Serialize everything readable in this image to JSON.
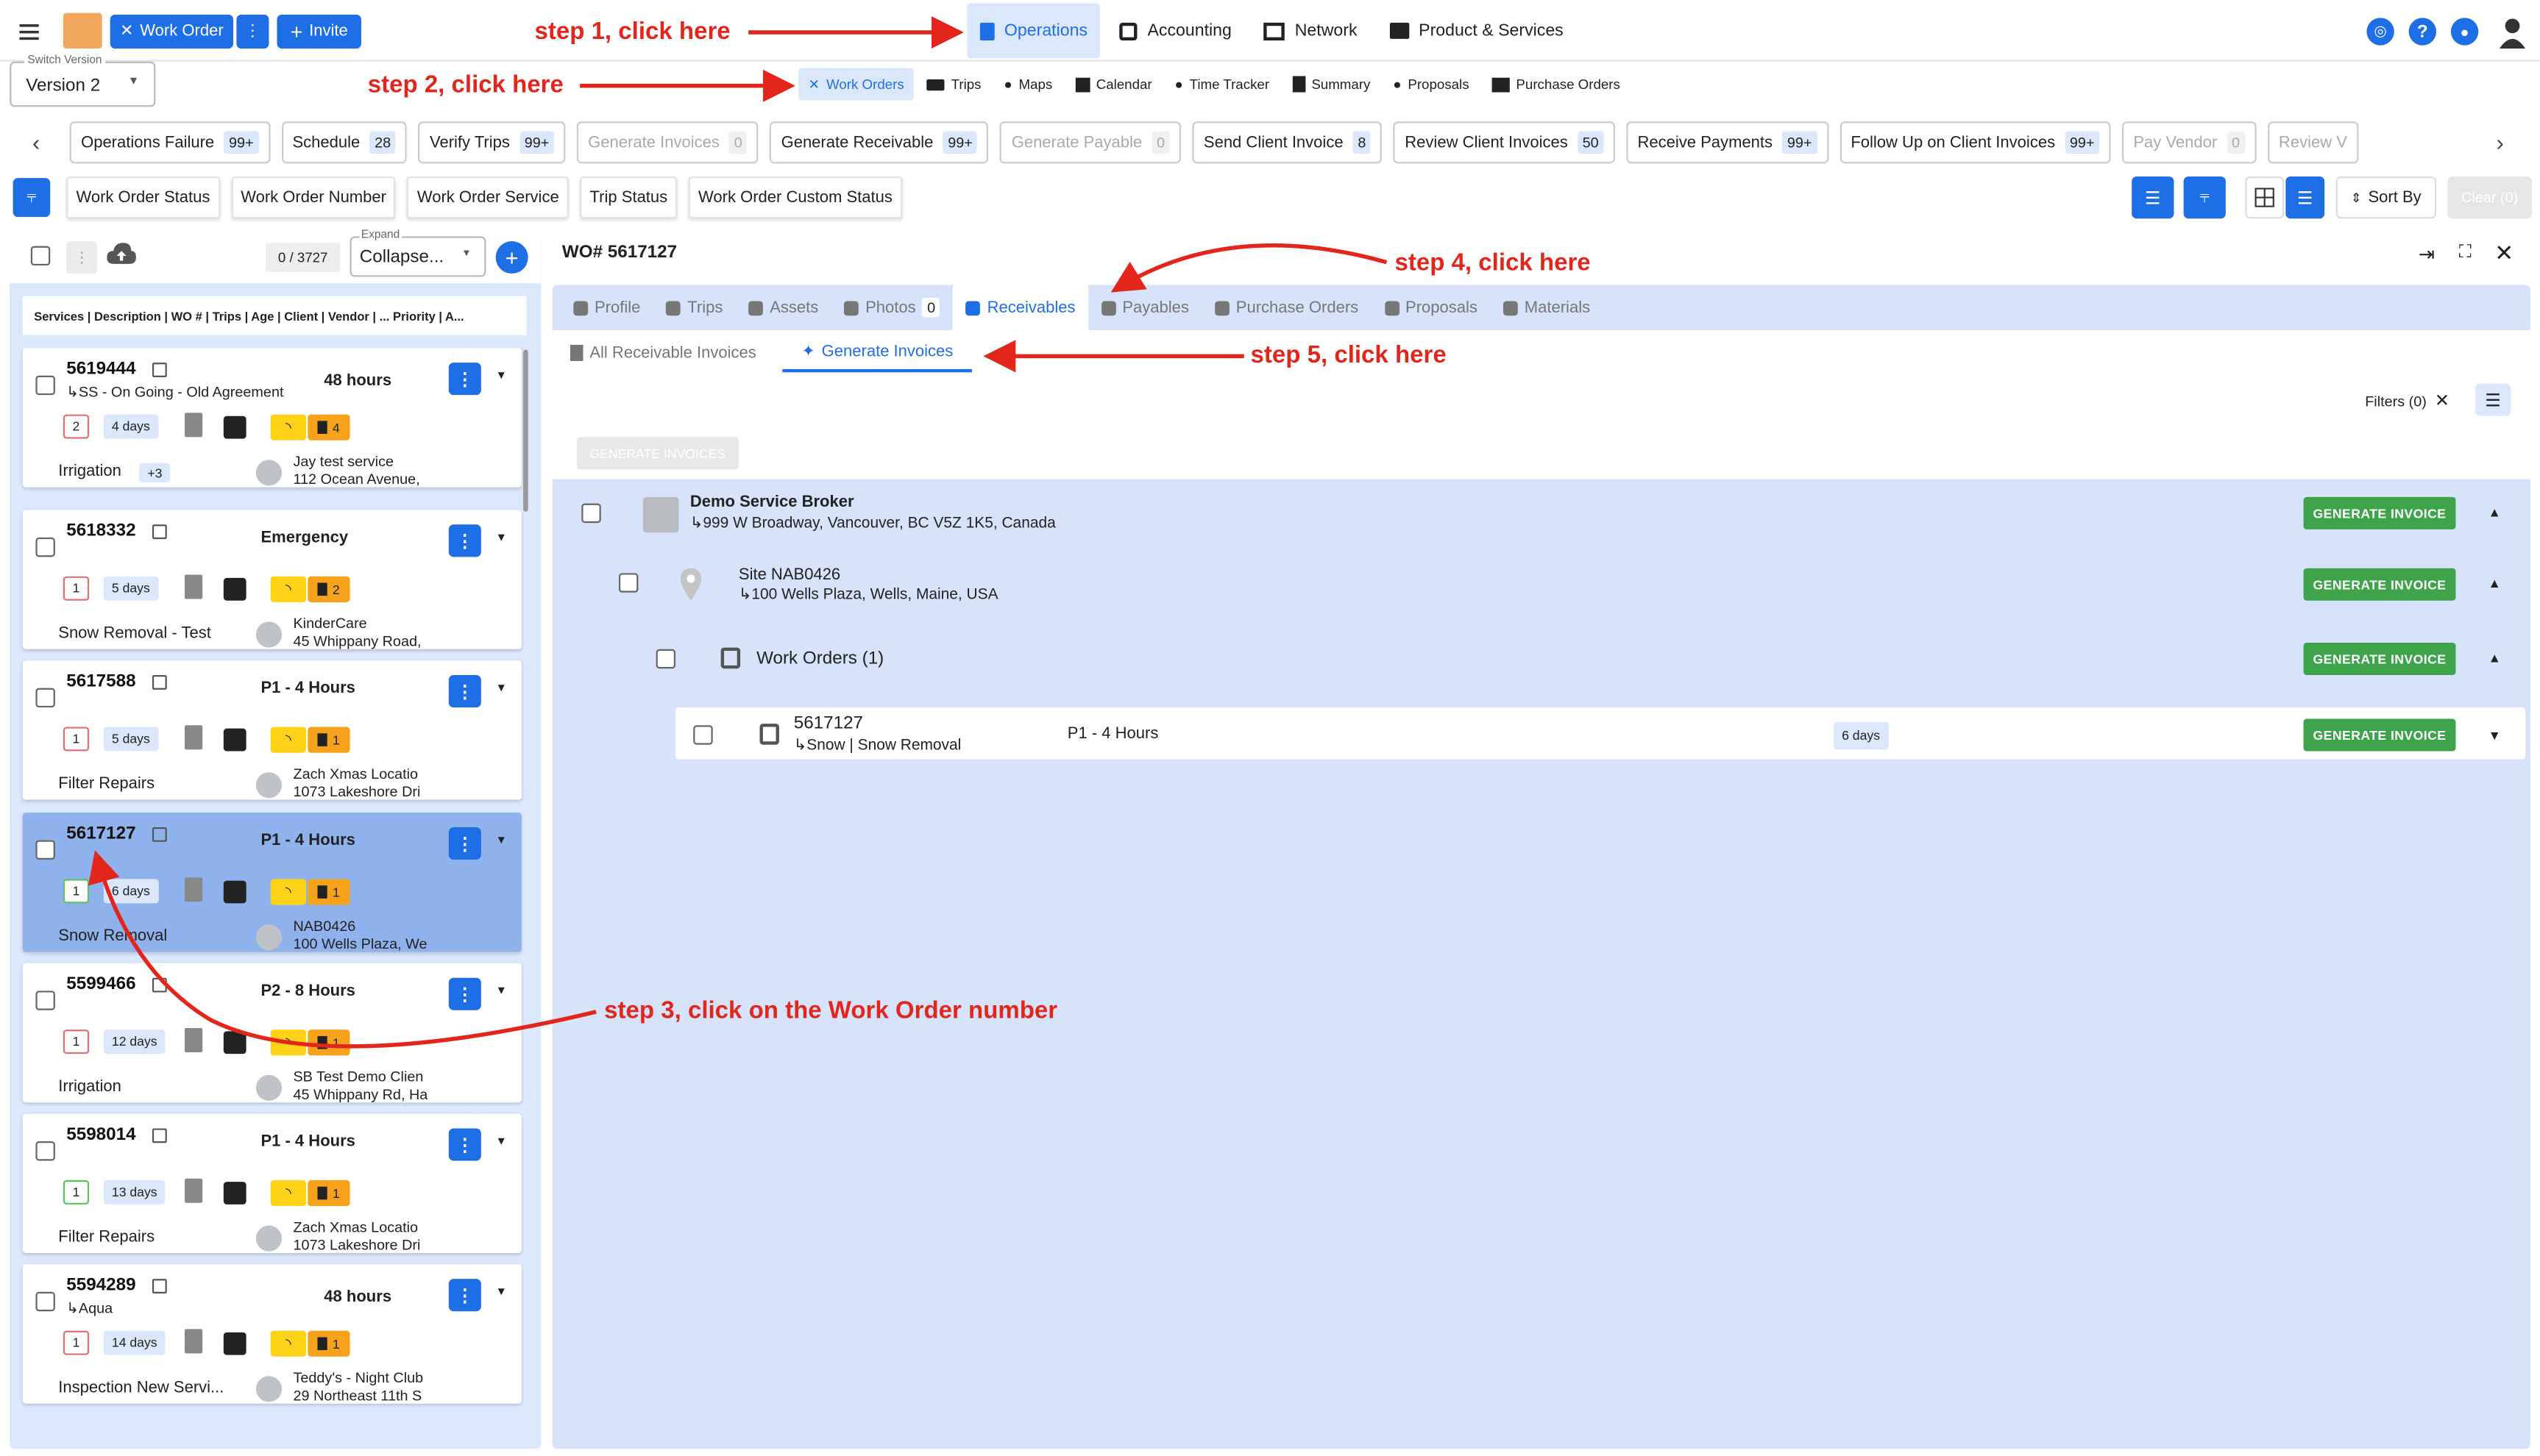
{
  "header": {
    "work_order_btn": "Work Order",
    "invite_btn": "Invite",
    "nav": [
      {
        "label": "Operations",
        "icon": "operations-icon"
      },
      {
        "label": "Accounting",
        "icon": "accounting-icon"
      },
      {
        "label": "Network",
        "icon": "network-icon"
      },
      {
        "label": "Product & Services",
        "icon": "product-icon"
      }
    ]
  },
  "version": {
    "label": "Switch Version",
    "value": "Version 2"
  },
  "subnav": [
    {
      "label": "Work Orders"
    },
    {
      "label": "Trips"
    },
    {
      "label": "Maps"
    },
    {
      "label": "Calendar"
    },
    {
      "label": "Time Tracker"
    },
    {
      "label": "Summary"
    },
    {
      "label": "Proposals"
    },
    {
      "label": "Purchase Orders"
    }
  ],
  "chips": [
    {
      "label": "Operations Failure",
      "count": "99+",
      "dis": false
    },
    {
      "label": "Schedule",
      "count": "28",
      "dis": false
    },
    {
      "label": "Verify Trips",
      "count": "99+",
      "dis": false
    },
    {
      "label": "Generate Invoices",
      "count": "0",
      "dis": true
    },
    {
      "label": "Generate Receivable",
      "count": "99+",
      "dis": false
    },
    {
      "label": "Generate Payable",
      "count": "0",
      "dis": true
    },
    {
      "label": "Send Client Invoice",
      "count": "8",
      "dis": false
    },
    {
      "label": "Review Client Invoices",
      "count": "50",
      "dis": false
    },
    {
      "label": "Receive Payments",
      "count": "99+",
      "dis": false
    },
    {
      "label": "Follow Up on Client Invoices",
      "count": "99+",
      "dis": false
    },
    {
      "label": "Pay Vendor",
      "count": "0",
      "dis": true
    },
    {
      "label": "Review V",
      "count": "",
      "dis": true
    }
  ],
  "filters": [
    "Work Order Status",
    "Work Order Number",
    "Work Order Service",
    "Trip Status",
    "Work Order Custom Status"
  ],
  "toolbar": {
    "sort_by": "Sort By",
    "clear": "Clear (0)"
  },
  "list": {
    "count": "0 / 3727",
    "expand_label": "Expand",
    "expand_value": "Collapse...",
    "header": "Services | Description | WO # | Trips | Age | Client | Vendor | ... Priority | A...",
    "cards": [
      {
        "num": "5619444",
        "sub": "↳SS - On Going - Old Agreement",
        "priority": "48 hours",
        "trips": "2",
        "days": "4 days",
        "count": "4",
        "service": "Irrigation",
        "extra": "+3",
        "client": "Jay test service",
        "address": "112 Ocean Avenue,",
        "tripsColor": "red",
        "sel": false
      },
      {
        "num": "5618332",
        "sub": "",
        "priority": "Emergency",
        "trips": "1",
        "days": "5 days",
        "count": "2",
        "service": "Snow Removal - Test",
        "extra": "",
        "client": "KinderCare",
        "address": "45 Whippany Road,",
        "tripsColor": "red",
        "sel": false
      },
      {
        "num": "5617588",
        "sub": "",
        "priority": "P1 - 4 Hours",
        "trips": "1",
        "days": "5 days",
        "count": "1",
        "service": "Filter Repairs",
        "extra": "",
        "client": "Zach Xmas Locatio",
        "address": "1073 Lakeshore Dri",
        "tripsColor": "red",
        "sel": false
      },
      {
        "num": "5617127",
        "sub": "",
        "priority": "P1 - 4 Hours",
        "trips": "1",
        "days": "6 days",
        "count": "1",
        "service": "Snow Removal",
        "extra": "",
        "client": "NAB0426",
        "address": "100 Wells Plaza, We",
        "tripsColor": "green",
        "sel": true
      },
      {
        "num": "5599466",
        "sub": "",
        "priority": "P2 - 8 Hours",
        "trips": "1",
        "days": "12 days",
        "count": "1",
        "service": "Irrigation",
        "extra": "",
        "client": "SB Test Demo Clien",
        "address": "45 Whippany Rd, Ha",
        "tripsColor": "red",
        "sel": false
      },
      {
        "num": "5598014",
        "sub": "",
        "priority": "P1 - 4 Hours",
        "trips": "1",
        "days": "13 days",
        "count": "1",
        "service": "Filter Repairs",
        "extra": "",
        "client": "Zach Xmas Locatio",
        "address": "1073 Lakeshore Dri",
        "tripsColor": "green",
        "sel": false
      },
      {
        "num": "5594289",
        "sub": "↳Aqua",
        "priority": "48 hours",
        "trips": "1",
        "days": "14 days",
        "count": "1",
        "service": "Inspection New Servi...",
        "extra": "",
        "client": "Teddy's - Night Club",
        "address": "29 Northeast 11th S",
        "tripsColor": "red",
        "sel": false
      }
    ]
  },
  "detail": {
    "title": "WO# 5617127",
    "tabs": [
      {
        "label": "Profile"
      },
      {
        "label": "Trips"
      },
      {
        "label": "Assets"
      },
      {
        "label": "Photos",
        "badge": "0"
      },
      {
        "label": "Receivables"
      },
      {
        "label": "Payables"
      },
      {
        "label": "Purchase Orders"
      },
      {
        "label": "Proposals"
      },
      {
        "label": "Materials"
      }
    ],
    "subtabs": [
      "All Receivable Invoices",
      "Generate Invoices"
    ],
    "filters": "Filters (0)",
    "gen_invoices_disabled": "GENERATE INVOICES",
    "gen_invoice": "GENERATE INVOICE",
    "tree": {
      "client_name": "Demo Service Broker",
      "client_addr": "↳999 W Broadway, Vancouver, BC V5Z 1K5, Canada",
      "site_name": "Site NAB0426",
      "site_addr": "↳100 Wells Plaza, Wells, Maine, USA",
      "wo_group": "Work Orders (1)",
      "wo_num": "5617127",
      "wo_sub": "↳Snow | Snow Removal",
      "wo_priority": "P1 - 4 Hours",
      "wo_age": "6 days"
    }
  },
  "annotations": {
    "step1": "step 1, click here",
    "step2": "step 2, click here",
    "step3": "step 3, click on the Work Order number",
    "step4": "step 4, click here",
    "step5": "step 5, click here"
  },
  "colors": {
    "accent": "#1e6fe6",
    "green": "#3ea34b",
    "annotation": "#e3261b",
    "panel": "#d6e3fa"
  }
}
